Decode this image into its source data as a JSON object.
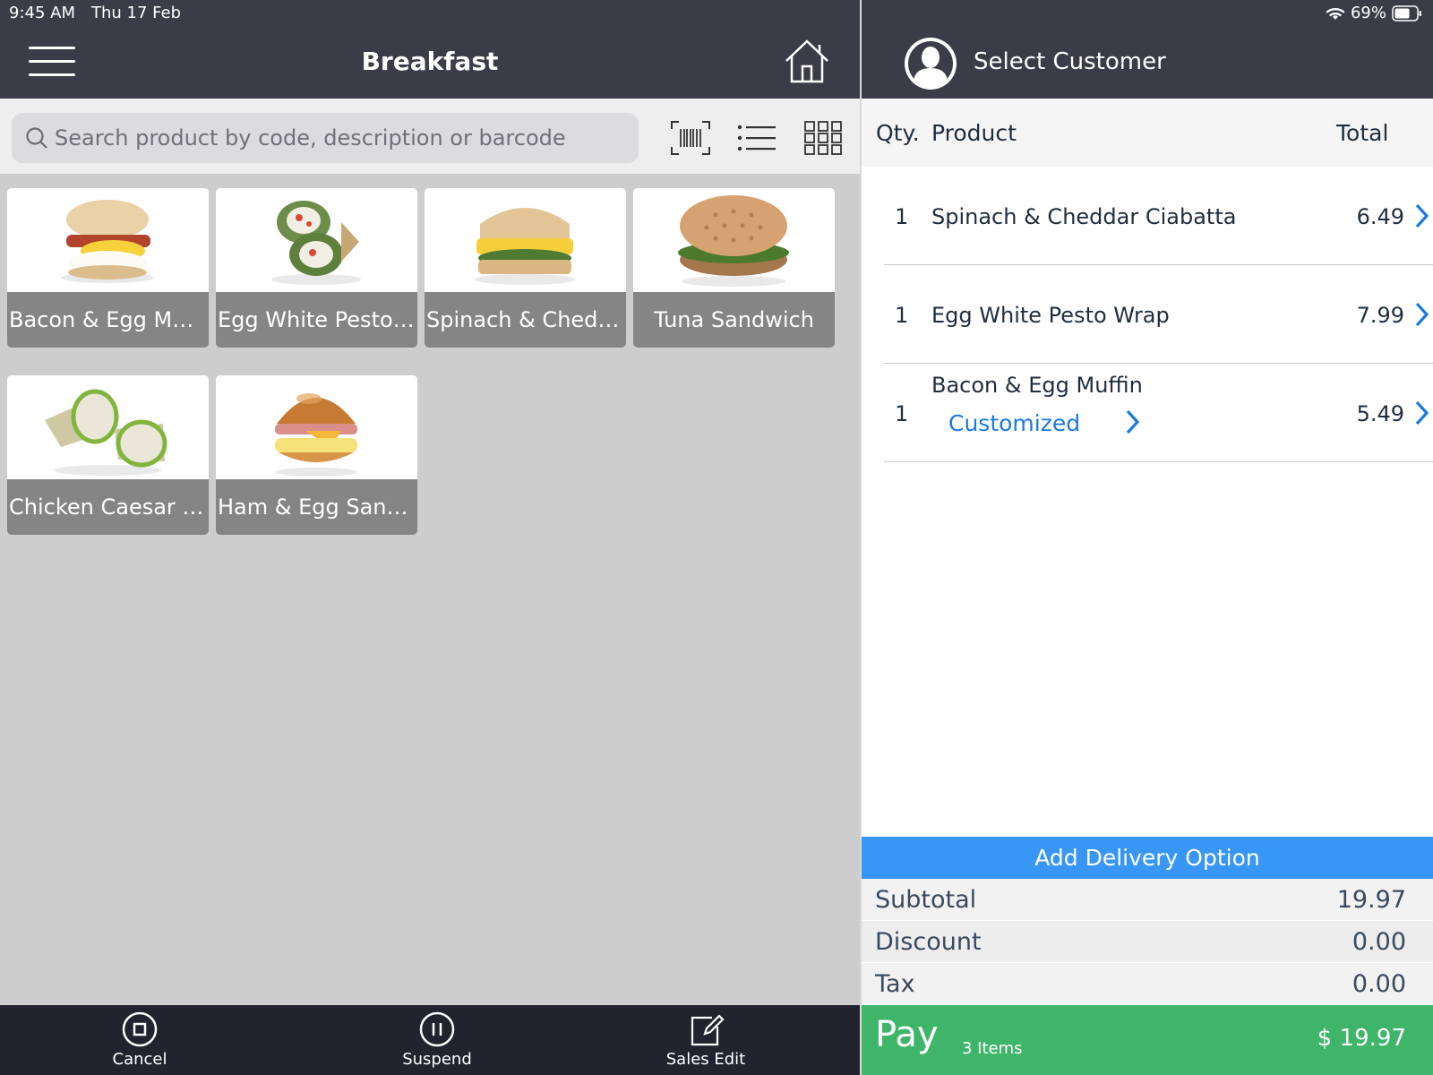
{
  "status": {
    "time": "9:45 AM",
    "date": "Thu 17 Feb",
    "battery": "69%"
  },
  "header": {
    "title": "Breakfast"
  },
  "search": {
    "placeholder": "Search product by code, description or barcode"
  },
  "products": [
    {
      "label": "Bacon & Egg Muffin",
      "image": "muffin-image"
    },
    {
      "label": "Egg White Pesto Wrap",
      "image": "wrap-image"
    },
    {
      "label": "Spinach & Cheddar Ciabatta",
      "image": "ciabatta-image"
    },
    {
      "label": "Tuna Sandwich",
      "image": "tuna-sandwich-image"
    },
    {
      "label": "Chicken Caesar Wrap",
      "image": "caesar-wrap-image"
    },
    {
      "label": "Ham & Egg Sandwich",
      "image": "ham-egg-sandwich-image"
    }
  ],
  "bottom_bar": {
    "cancel": "Cancel",
    "suspend": "Suspend",
    "sales_edit": "Sales Edit"
  },
  "customer": {
    "label": "Select Customer"
  },
  "cart": {
    "headers": {
      "qty": "Qty.",
      "product": "Product",
      "total": "Total"
    },
    "lines": [
      {
        "qty": "1",
        "name": "Spinach & Cheddar Ciabatta",
        "total": "6.49"
      },
      {
        "qty": "1",
        "name": "Egg White Pesto Wrap",
        "total": "7.99"
      },
      {
        "qty": "1",
        "name": "Bacon & Egg Muffin",
        "total": "5.49",
        "modifier": "Customized"
      }
    ]
  },
  "delivery": {
    "label": "Add Delivery Option"
  },
  "summary": {
    "subtotal_label": "Subtotal",
    "subtotal": "19.97",
    "discount_label": "Discount",
    "discount": "0.00",
    "tax_label": "Tax",
    "tax": "0.00"
  },
  "pay": {
    "label": "Pay",
    "items": "3 Items",
    "amount": "$ 19.97"
  },
  "colors": {
    "header": "#3b3c48",
    "accent": "#1a7ae0",
    "delivery": "#3896f6",
    "pay": "#3fb56a"
  }
}
